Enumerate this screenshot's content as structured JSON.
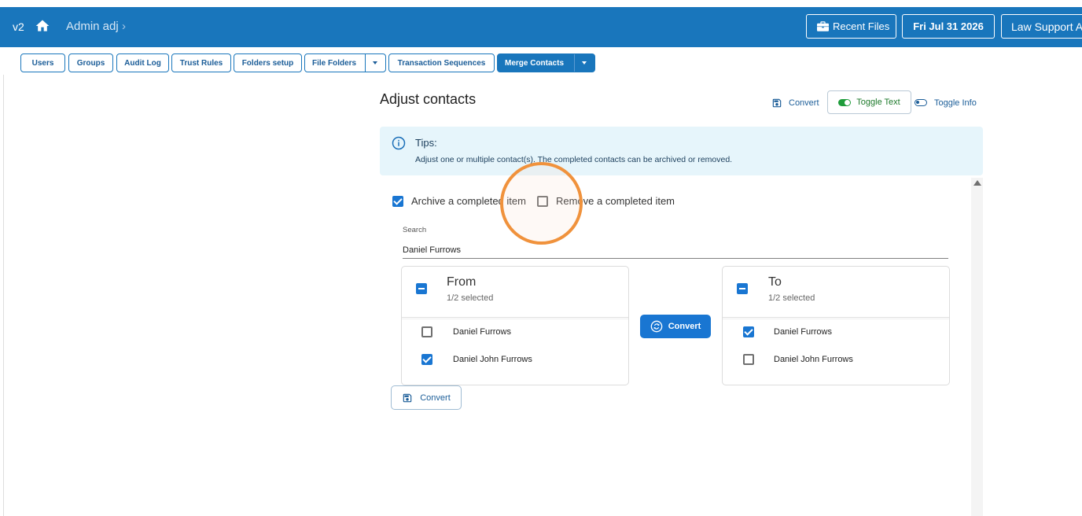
{
  "header": {
    "version": "v2",
    "breadcrumb": "Admin adj",
    "recent_files": "Recent Files",
    "date": "Fri Jul 31 2026",
    "user": "Law Support A"
  },
  "nav": {
    "users": "Users",
    "groups": "Groups",
    "audit_log": "Audit Log",
    "trust_rules": "Trust Rules",
    "folders_setup": "Folders setup",
    "file_folders": "File Folders",
    "transaction_sequences": "Transaction Sequences",
    "merge_contacts": "Merge Contacts"
  },
  "page": {
    "title": "Adjust contacts"
  },
  "toolbar": {
    "convert": "Convert",
    "toggle_text": "Toggle Text",
    "toggle_info": "Toggle Info"
  },
  "tips": {
    "title": "Tips:",
    "text": "Adjust one or multiple contact(s). The completed contacts can be archived or removed."
  },
  "options": {
    "archive_label": "Archive a completed item",
    "archive_checked": true,
    "remove_label": "Remove a completed item",
    "remove_checked": false
  },
  "search": {
    "label": "Search",
    "value": "Daniel Furrows"
  },
  "from_list": {
    "title": "From",
    "subtitle": "1/2 selected",
    "items": [
      {
        "label": "Daniel Furrows",
        "checked": false
      },
      {
        "label": "Daniel John Furrows",
        "checked": true
      }
    ]
  },
  "to_list": {
    "title": "To",
    "subtitle": "1/2 selected",
    "items": [
      {
        "label": "Daniel Furrows",
        "checked": true
      },
      {
        "label": "Daniel John Furrows",
        "checked": false
      }
    ]
  },
  "move_button": "Convert",
  "bottom_convert": "Convert",
  "colors": {
    "header_bg": "#1976bc",
    "primary": "#1976d2",
    "tips_bg": "#e6f5fb",
    "toggle_on": "#1e9c3a",
    "cursor_ring": "#f0923c"
  }
}
